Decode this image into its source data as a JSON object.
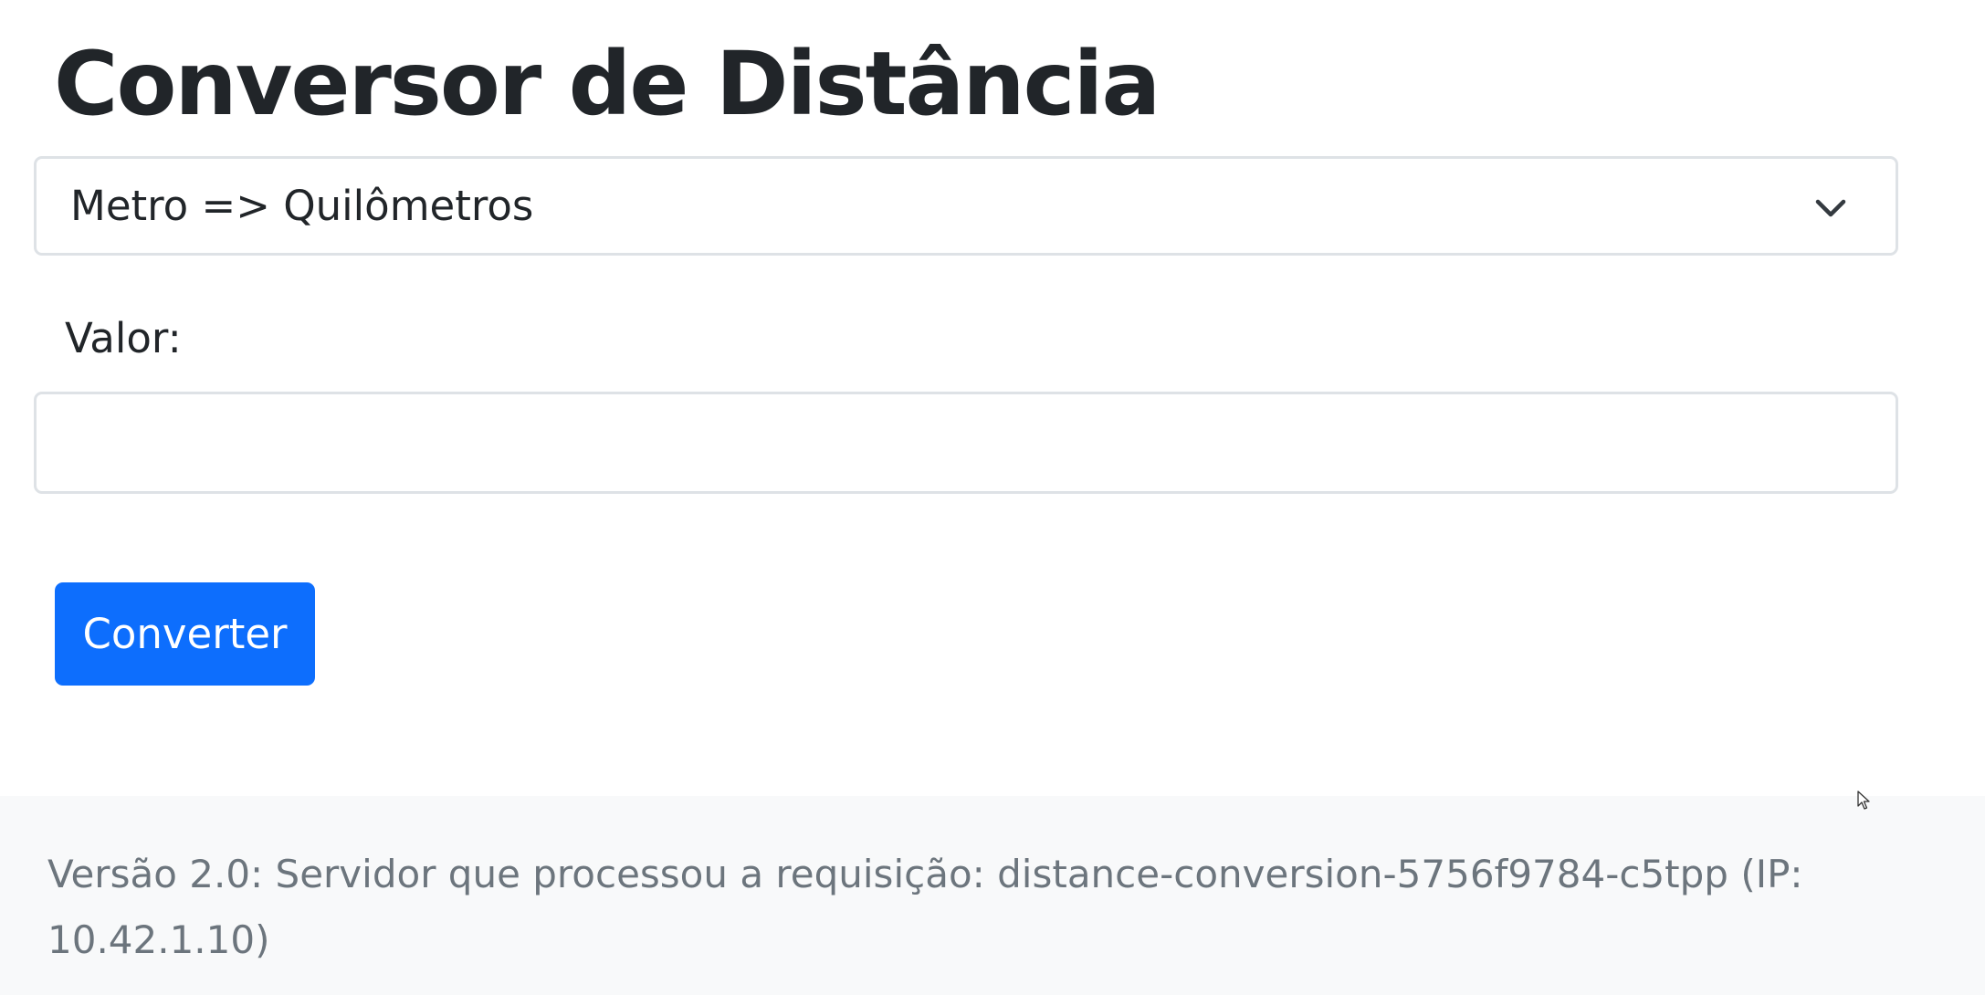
{
  "header": {
    "title": "Conversor de Distância"
  },
  "form": {
    "conversion_select": {
      "selected": "Metro => Quilômetros",
      "icon": "chevron-down-icon"
    },
    "value_label": "Valor:",
    "value_input": {
      "value": "",
      "placeholder": ""
    },
    "convert_button_label": "Converter"
  },
  "footer": {
    "text": "Versão 2.0: Servidor que processou a requisição: distance-conversion-5756f9784-c5tpp (IP: 10.42.1.10)"
  },
  "colors": {
    "primary": "#0d6efd",
    "text": "#212529",
    "muted": "#6c757d",
    "footer_bg": "#f8f9fa",
    "border": "#dee2e6"
  }
}
